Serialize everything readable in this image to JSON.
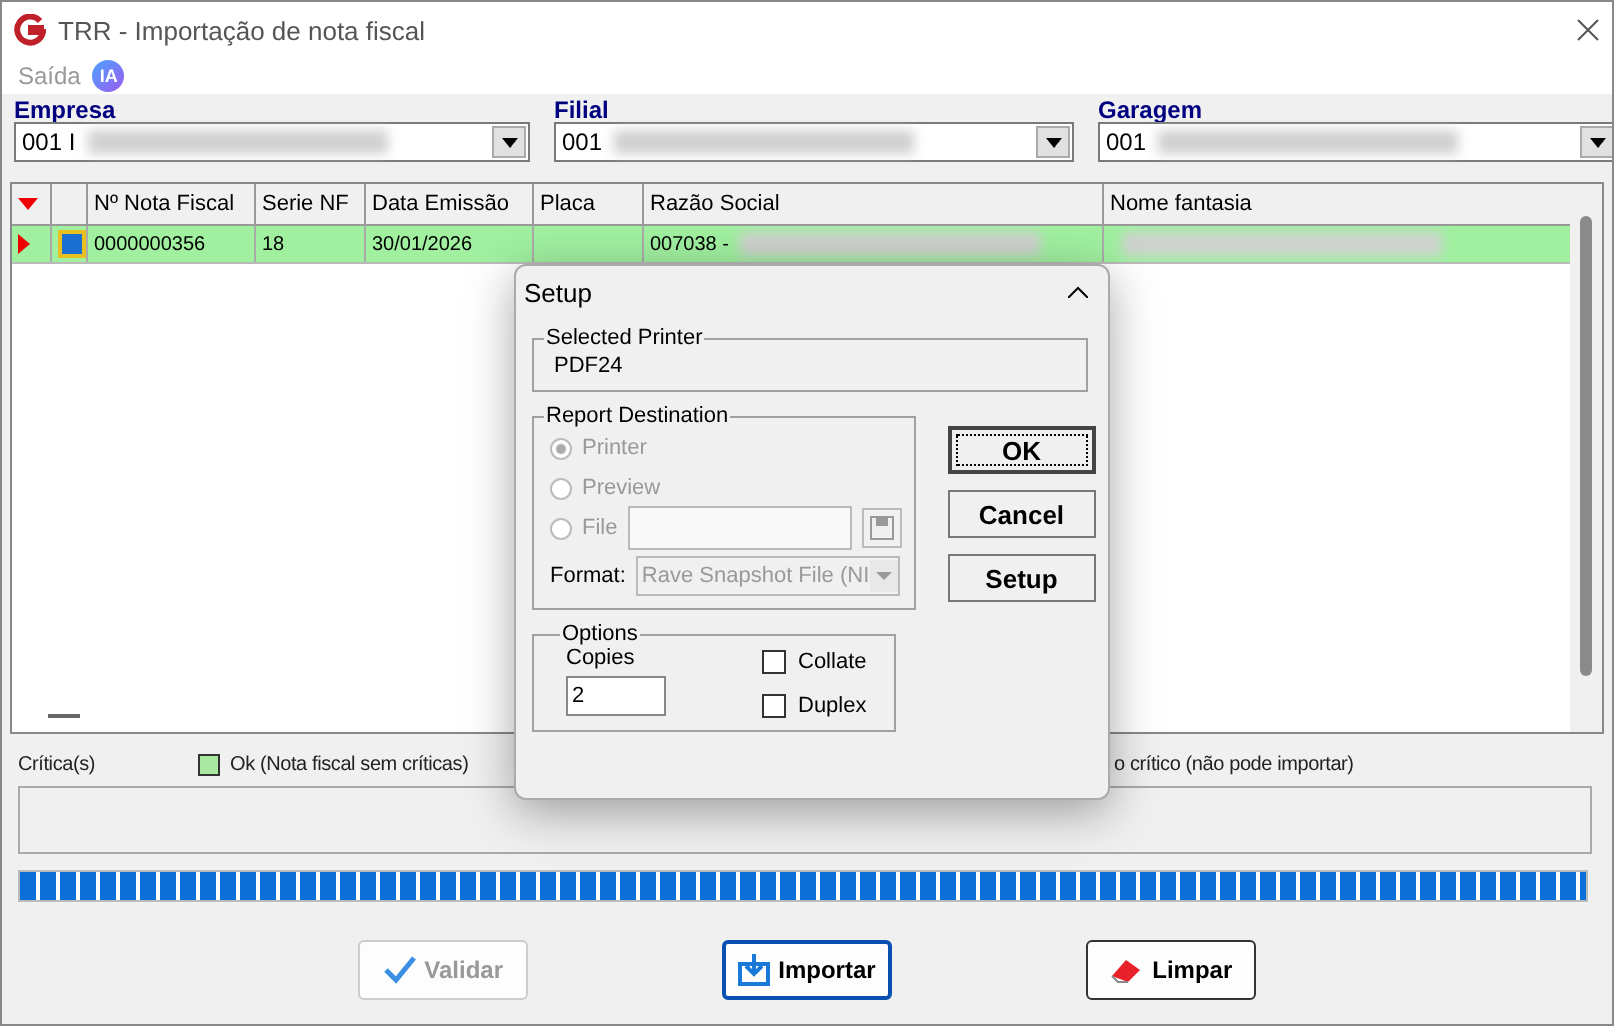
{
  "window": {
    "title": "TRR - Importação de nota fiscal"
  },
  "menu": [
    {
      "label": "Saída",
      "disabled": true
    }
  ],
  "ia_badge": "IA",
  "filters": [
    {
      "label": "Empresa",
      "value": "001 I"
    },
    {
      "label": "Filial",
      "value": "001"
    },
    {
      "label": "Garagem",
      "value": "001"
    }
  ],
  "table": {
    "columns": [
      "Nº Nota Fiscal",
      "Serie NF",
      "Data Emissão",
      "Placa",
      "Razão Social",
      "Nome fantasia"
    ],
    "rows": [
      {
        "selected": true,
        "checked": true,
        "cells": [
          "0000000356",
          "18",
          "30/01/2026",
          null,
          "007038 -",
          null
        ]
      }
    ]
  },
  "legend": {
    "label": "Crítica(s)",
    "items": [
      {
        "text": "Ok (Nota fiscal sem críticas)",
        "color": "#a8e8a0"
      },
      {
        "text": "o crítico (não pode importar)"
      }
    ]
  },
  "progress": {
    "level": 1
  },
  "buttons": [
    {
      "label": "Validar",
      "kind": "validate",
      "disabled": true
    },
    {
      "label": "Importar",
      "kind": "import",
      "disabled": false
    },
    {
      "label": "Limpar",
      "kind": "clear",
      "disabled": false
    }
  ],
  "dialog": {
    "title": "Setup",
    "selected_printer": {
      "label": "Selected Printer",
      "value": "PDF24"
    },
    "destination": {
      "label": "Report Destination",
      "disabled": true,
      "options": [
        {
          "label": "Printer",
          "selected": true
        },
        {
          "label": "Preview",
          "selected": false
        },
        {
          "label": "File",
          "selected": false
        }
      ],
      "format_label": "Format:",
      "format_value": "Rave Snapshot File (NI"
    },
    "options": {
      "label": "Options",
      "copies_label": "Copies",
      "copies": "2",
      "checks": [
        {
          "label": "Collate",
          "checked": false
        },
        {
          "label": "Duplex",
          "checked": false
        }
      ]
    },
    "buttons": [
      "OK",
      "Cancel",
      "Setup"
    ]
  }
}
